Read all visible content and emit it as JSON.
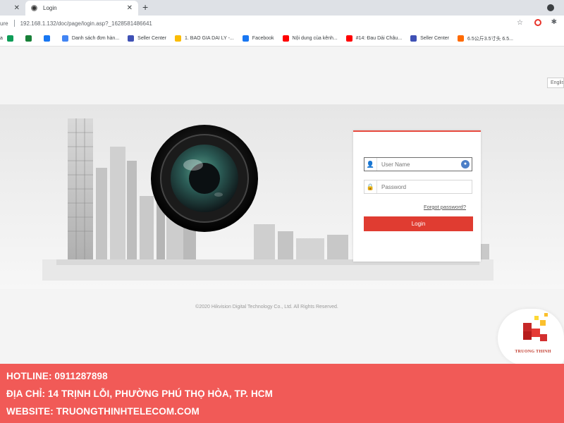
{
  "browser": {
    "tabs": [
      {
        "title": "",
        "active": false
      },
      {
        "title": "Login",
        "active": true
      }
    ],
    "address": {
      "secure_label": "ure",
      "url": "192.168.1.132/doc/page/login.asp?_1628581486641"
    },
    "bookmarks": [
      {
        "label": "a",
        "icon": "green-app-icon",
        "color": "#0f9d58"
      },
      {
        "label": "",
        "icon": "green-grid-icon",
        "color": "#188038"
      },
      {
        "label": "",
        "icon": "facebook-icon",
        "color": "#1877f2"
      },
      {
        "label": "Danh sách đơn hàn...",
        "icon": "list-icon",
        "color": "#4285f4"
      },
      {
        "label": "Seller Center",
        "icon": "heart-icon",
        "color": "#3f51b5"
      },
      {
        "label": "1. BAO GIA DAI LY -...",
        "icon": "drive-icon",
        "color": "#fbbc04"
      },
      {
        "label": "Facebook",
        "icon": "facebook-icon",
        "color": "#1877f2"
      },
      {
        "label": "Nội dung của kênh...",
        "icon": "youtube-icon",
        "color": "#ff0000"
      },
      {
        "label": "#14: Đau Dải Châu...",
        "icon": "youtube-icon",
        "color": "#ff0000"
      },
      {
        "label": "Seller Center",
        "icon": "heart-icon",
        "color": "#3f51b5"
      },
      {
        "label": "6.5公斤3.5寸头 6.5...",
        "icon": "orange-store-icon",
        "color": "#ff6a00"
      }
    ]
  },
  "login_page": {
    "language": "English",
    "username_placeholder": "User Name",
    "password_placeholder": "Password",
    "forgot_label": "Forgot password?",
    "login_label": "Login",
    "copyright": "©2020 Hikvision Digital Technology Co., Ltd. All Rights Reserved.",
    "accent_color": "#e03c31"
  },
  "branding": {
    "company": "TRUONG THINH",
    "hotline": "HOTLINE: 0911287898",
    "address": "ĐỊA CHỈ: 14 TRỊNH LỖI, PHƯỜNG PHÚ THỌ HÒA, TP. HCM",
    "website": "WEBSITE: TRUONGTHINHTELECOM.COM",
    "footer_color": "#f15a57"
  }
}
